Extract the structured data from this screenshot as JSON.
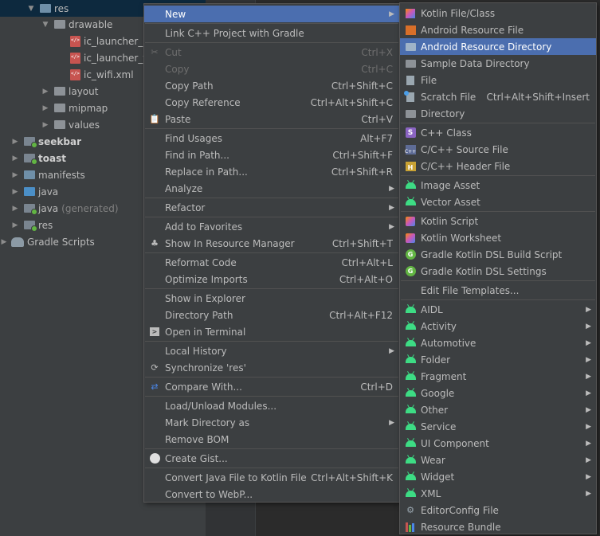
{
  "tree": {
    "items": [
      {
        "label": "res",
        "icon": "folder-icon",
        "arrow": "▼"
      },
      {
        "label": "drawable",
        "icon": "folder-icon",
        "arrow": "▼"
      },
      {
        "label": "ic_launcher_ba",
        "icon": "xml-file-icon"
      },
      {
        "label": "ic_launcher_fo",
        "icon": "xml-file-icon"
      },
      {
        "label": "ic_wifi.xml",
        "icon": "xml-file-icon"
      },
      {
        "label": "layout",
        "icon": "folder-icon",
        "arrow": "▶"
      },
      {
        "label": "mipmap",
        "icon": "folder-icon",
        "arrow": "▶"
      },
      {
        "label": "values",
        "icon": "folder-icon",
        "arrow": "▶"
      },
      {
        "label": "seekbar",
        "icon": "module-folder-icon",
        "arrow": "▶"
      },
      {
        "label": "toast",
        "icon": "module-folder-icon",
        "arrow": "▶"
      },
      {
        "label": "manifests",
        "icon": "folder-icon",
        "arrow": "▶"
      },
      {
        "label": "java",
        "icon": "folder-icon",
        "arrow": "▶"
      },
      {
        "label": "java",
        "suffix": "(generated)",
        "icon": "generated-folder-icon",
        "arrow": "▶"
      },
      {
        "label": "res",
        "icon": "folder-icon",
        "arrow": "▶"
      },
      {
        "label": "Gradle Scripts",
        "icon": "gradle-elephant-icon",
        "arrow": "▶"
      }
    ]
  },
  "main_menu": {
    "items": [
      {
        "label": "New",
        "shortcut": "",
        "submenu": true,
        "active": true
      },
      {
        "label": "Link C++ Project with Gradle",
        "shortcut": ""
      },
      {
        "label": "Cut",
        "shortcut": "Ctrl+X",
        "disabled": true,
        "icon": "scissors-icon"
      },
      {
        "label": "Copy",
        "shortcut": "Ctrl+C",
        "disabled": true
      },
      {
        "label": "Copy Path",
        "shortcut": "Ctrl+Shift+C"
      },
      {
        "label": "Copy Reference",
        "shortcut": "Ctrl+Alt+Shift+C"
      },
      {
        "label": "Paste",
        "shortcut": "Ctrl+V",
        "icon": "clipboard-icon"
      },
      {
        "label": "Find Usages",
        "shortcut": "Alt+F7"
      },
      {
        "label": "Find in Path...",
        "shortcut": "Ctrl+Shift+F"
      },
      {
        "label": "Replace in Path...",
        "shortcut": "Ctrl+Shift+R"
      },
      {
        "label": "Analyze",
        "shortcut": "",
        "submenu": true
      },
      {
        "label": "Refactor",
        "shortcut": "",
        "submenu": true
      },
      {
        "label": "Add to Favorites",
        "shortcut": "",
        "submenu": true
      },
      {
        "label": "Show In Resource Manager",
        "shortcut": "Ctrl+Shift+T",
        "icon": "resource-manager-icon"
      },
      {
        "label": "Reformat Code",
        "shortcut": "Ctrl+Alt+L"
      },
      {
        "label": "Optimize Imports",
        "shortcut": "Ctrl+Alt+O"
      },
      {
        "label": "Show in Explorer",
        "shortcut": ""
      },
      {
        "label": "Directory Path",
        "shortcut": "Ctrl+Alt+F12"
      },
      {
        "label": "Open in Terminal",
        "shortcut": "",
        "icon": "terminal-icon"
      },
      {
        "label": "Local History",
        "shortcut": "",
        "submenu": true
      },
      {
        "label": "Synchronize 'res'",
        "shortcut": "",
        "icon": "sync-icon"
      },
      {
        "label": "Compare With...",
        "shortcut": "Ctrl+D",
        "icon": "compare-icon"
      },
      {
        "label": "Load/Unload Modules...",
        "shortcut": ""
      },
      {
        "label": "Mark Directory as",
        "shortcut": "",
        "submenu": true
      },
      {
        "label": "Remove BOM",
        "shortcut": ""
      },
      {
        "label": "Create Gist...",
        "shortcut": "",
        "icon": "github-icon"
      },
      {
        "label": "Convert Java File to Kotlin File",
        "shortcut": "Ctrl+Alt+Shift+K"
      },
      {
        "label": "Convert to WebP...",
        "shortcut": ""
      }
    ]
  },
  "sub_menu": {
    "items": [
      {
        "label": "Kotlin File/Class",
        "icon": "kotlin-icon"
      },
      {
        "label": "Android Resource File",
        "icon": "android-resource-file-icon"
      },
      {
        "label": "Android Resource Directory",
        "icon": "folder-icon",
        "active": true
      },
      {
        "label": "Sample Data Directory",
        "icon": "folder-icon"
      },
      {
        "label": "File",
        "icon": "file-icon"
      },
      {
        "label": "Scratch File",
        "shortcut": "Ctrl+Alt+Shift+Insert",
        "icon": "scratch-file-icon"
      },
      {
        "label": "Directory",
        "icon": "folder-icon"
      },
      {
        "label": "C++ Class",
        "icon": "cpp-class-icon"
      },
      {
        "label": "C/C++ Source File",
        "icon": "cpp-source-icon"
      },
      {
        "label": "C/C++ Header File",
        "icon": "cpp-header-icon"
      },
      {
        "label": "Image Asset",
        "icon": "android-icon"
      },
      {
        "label": "Vector Asset",
        "icon": "android-icon"
      },
      {
        "label": "Kotlin Script",
        "icon": "kotlin-script-icon"
      },
      {
        "label": "Kotlin Worksheet",
        "icon": "kotlin-worksheet-icon"
      },
      {
        "label": "Gradle Kotlin DSL Build Script",
        "icon": "gradle-icon"
      },
      {
        "label": "Gradle Kotlin DSL Settings",
        "icon": "gradle-icon"
      },
      {
        "label": "Edit File Templates...",
        "icon": ""
      },
      {
        "label": "AIDL",
        "icon": "android-icon",
        "submenu": true
      },
      {
        "label": "Activity",
        "icon": "android-icon",
        "submenu": true
      },
      {
        "label": "Automotive",
        "icon": "android-icon",
        "submenu": true
      },
      {
        "label": "Folder",
        "icon": "android-icon",
        "submenu": true
      },
      {
        "label": "Fragment",
        "icon": "android-icon",
        "submenu": true
      },
      {
        "label": "Google",
        "icon": "android-icon",
        "submenu": true
      },
      {
        "label": "Other",
        "icon": "android-icon",
        "submenu": true
      },
      {
        "label": "Service",
        "icon": "android-icon",
        "submenu": true
      },
      {
        "label": "UI Component",
        "icon": "android-icon",
        "submenu": true
      },
      {
        "label": "Wear",
        "icon": "android-icon",
        "submenu": true
      },
      {
        "label": "Widget",
        "icon": "android-icon",
        "submenu": true
      },
      {
        "label": "XML",
        "icon": "android-icon",
        "submenu": true
      },
      {
        "label": "EditorConfig File",
        "icon": "gear-icon"
      },
      {
        "label": "Resource Bundle",
        "icon": "resource-bundle-icon"
      }
    ]
  },
  "colors": {
    "menu_bg": "#3c3f41",
    "selection": "#4b6eaf",
    "tree_bg": "#3c3f41",
    "editor_bg": "#2b2b2b"
  }
}
